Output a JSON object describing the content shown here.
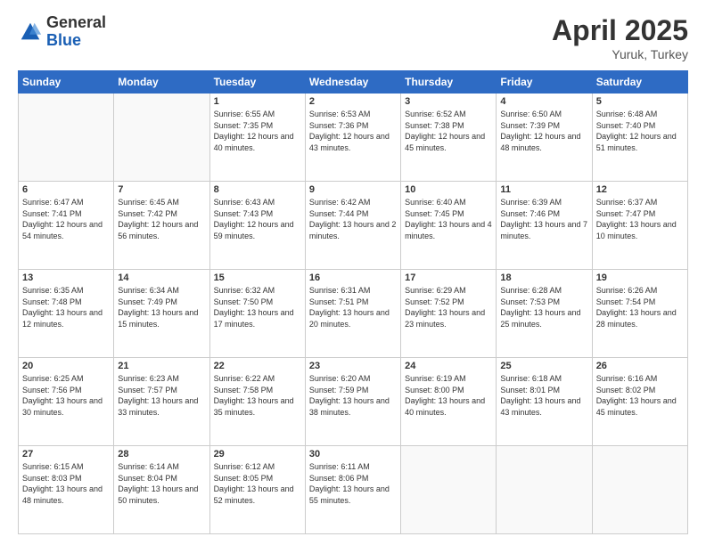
{
  "header": {
    "logo_general": "General",
    "logo_blue": "Blue",
    "month_title": "April 2025",
    "location": "Yuruk, Turkey"
  },
  "weekdays": [
    "Sunday",
    "Monday",
    "Tuesday",
    "Wednesday",
    "Thursday",
    "Friday",
    "Saturday"
  ],
  "weeks": [
    [
      {
        "day": "",
        "info": ""
      },
      {
        "day": "",
        "info": ""
      },
      {
        "day": "1",
        "info": "Sunrise: 6:55 AM\nSunset: 7:35 PM\nDaylight: 12 hours and 40 minutes."
      },
      {
        "day": "2",
        "info": "Sunrise: 6:53 AM\nSunset: 7:36 PM\nDaylight: 12 hours and 43 minutes."
      },
      {
        "day": "3",
        "info": "Sunrise: 6:52 AM\nSunset: 7:38 PM\nDaylight: 12 hours and 45 minutes."
      },
      {
        "day": "4",
        "info": "Sunrise: 6:50 AM\nSunset: 7:39 PM\nDaylight: 12 hours and 48 minutes."
      },
      {
        "day": "5",
        "info": "Sunrise: 6:48 AM\nSunset: 7:40 PM\nDaylight: 12 hours and 51 minutes."
      }
    ],
    [
      {
        "day": "6",
        "info": "Sunrise: 6:47 AM\nSunset: 7:41 PM\nDaylight: 12 hours and 54 minutes."
      },
      {
        "day": "7",
        "info": "Sunrise: 6:45 AM\nSunset: 7:42 PM\nDaylight: 12 hours and 56 minutes."
      },
      {
        "day": "8",
        "info": "Sunrise: 6:43 AM\nSunset: 7:43 PM\nDaylight: 12 hours and 59 minutes."
      },
      {
        "day": "9",
        "info": "Sunrise: 6:42 AM\nSunset: 7:44 PM\nDaylight: 13 hours and 2 minutes."
      },
      {
        "day": "10",
        "info": "Sunrise: 6:40 AM\nSunset: 7:45 PM\nDaylight: 13 hours and 4 minutes."
      },
      {
        "day": "11",
        "info": "Sunrise: 6:39 AM\nSunset: 7:46 PM\nDaylight: 13 hours and 7 minutes."
      },
      {
        "day": "12",
        "info": "Sunrise: 6:37 AM\nSunset: 7:47 PM\nDaylight: 13 hours and 10 minutes."
      }
    ],
    [
      {
        "day": "13",
        "info": "Sunrise: 6:35 AM\nSunset: 7:48 PM\nDaylight: 13 hours and 12 minutes."
      },
      {
        "day": "14",
        "info": "Sunrise: 6:34 AM\nSunset: 7:49 PM\nDaylight: 13 hours and 15 minutes."
      },
      {
        "day": "15",
        "info": "Sunrise: 6:32 AM\nSunset: 7:50 PM\nDaylight: 13 hours and 17 minutes."
      },
      {
        "day": "16",
        "info": "Sunrise: 6:31 AM\nSunset: 7:51 PM\nDaylight: 13 hours and 20 minutes."
      },
      {
        "day": "17",
        "info": "Sunrise: 6:29 AM\nSunset: 7:52 PM\nDaylight: 13 hours and 23 minutes."
      },
      {
        "day": "18",
        "info": "Sunrise: 6:28 AM\nSunset: 7:53 PM\nDaylight: 13 hours and 25 minutes."
      },
      {
        "day": "19",
        "info": "Sunrise: 6:26 AM\nSunset: 7:54 PM\nDaylight: 13 hours and 28 minutes."
      }
    ],
    [
      {
        "day": "20",
        "info": "Sunrise: 6:25 AM\nSunset: 7:56 PM\nDaylight: 13 hours and 30 minutes."
      },
      {
        "day": "21",
        "info": "Sunrise: 6:23 AM\nSunset: 7:57 PM\nDaylight: 13 hours and 33 minutes."
      },
      {
        "day": "22",
        "info": "Sunrise: 6:22 AM\nSunset: 7:58 PM\nDaylight: 13 hours and 35 minutes."
      },
      {
        "day": "23",
        "info": "Sunrise: 6:20 AM\nSunset: 7:59 PM\nDaylight: 13 hours and 38 minutes."
      },
      {
        "day": "24",
        "info": "Sunrise: 6:19 AM\nSunset: 8:00 PM\nDaylight: 13 hours and 40 minutes."
      },
      {
        "day": "25",
        "info": "Sunrise: 6:18 AM\nSunset: 8:01 PM\nDaylight: 13 hours and 43 minutes."
      },
      {
        "day": "26",
        "info": "Sunrise: 6:16 AM\nSunset: 8:02 PM\nDaylight: 13 hours and 45 minutes."
      }
    ],
    [
      {
        "day": "27",
        "info": "Sunrise: 6:15 AM\nSunset: 8:03 PM\nDaylight: 13 hours and 48 minutes."
      },
      {
        "day": "28",
        "info": "Sunrise: 6:14 AM\nSunset: 8:04 PM\nDaylight: 13 hours and 50 minutes."
      },
      {
        "day": "29",
        "info": "Sunrise: 6:12 AM\nSunset: 8:05 PM\nDaylight: 13 hours and 52 minutes."
      },
      {
        "day": "30",
        "info": "Sunrise: 6:11 AM\nSunset: 8:06 PM\nDaylight: 13 hours and 55 minutes."
      },
      {
        "day": "",
        "info": ""
      },
      {
        "day": "",
        "info": ""
      },
      {
        "day": "",
        "info": ""
      }
    ]
  ]
}
